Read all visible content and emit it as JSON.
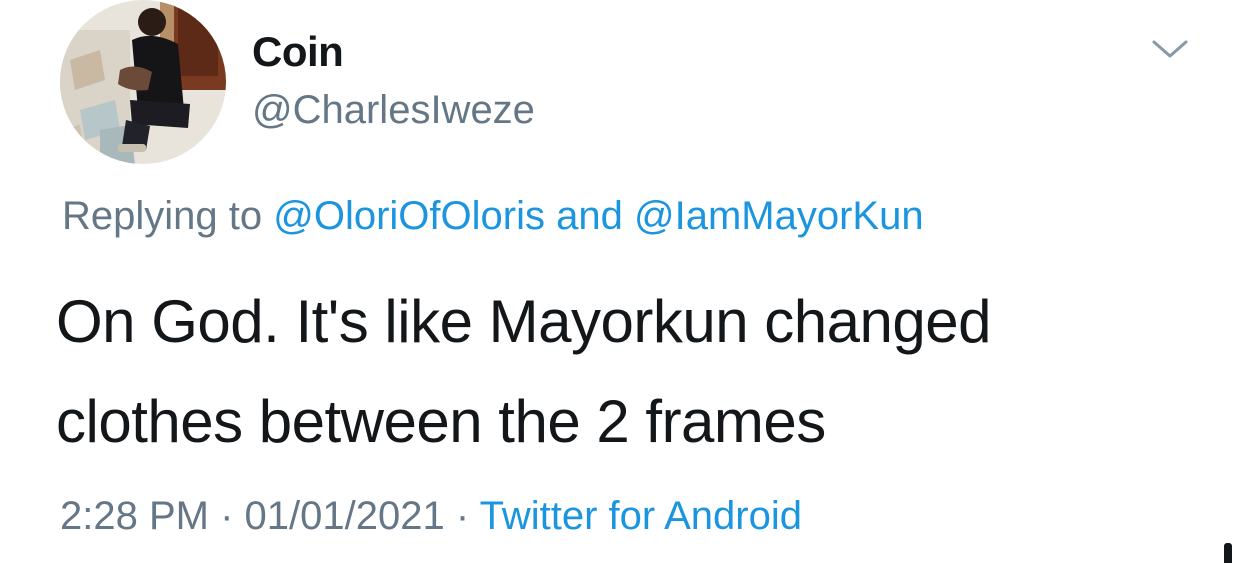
{
  "tweet": {
    "author": {
      "display_name": "Coin",
      "handle": "@CharlesIweze",
      "avatar_icon": "user-avatar-photo"
    },
    "reply": {
      "prefix": "Replying to",
      "mentions": [
        "@OloriOfOloris",
        "@IamMayorKun"
      ],
      "joiner": "and"
    },
    "text": "On God. It's like Mayorkun changed clothes between the 2 frames",
    "meta": {
      "time": "2:28 PM",
      "separator": "·",
      "date": "01/01/2021",
      "source": "Twitter for Android"
    },
    "menu_icon": "chevron-down-icon"
  },
  "colors": {
    "text": "#14171a",
    "secondary": "#657786",
    "link": "#1b95e0",
    "background": "#ffffff"
  }
}
